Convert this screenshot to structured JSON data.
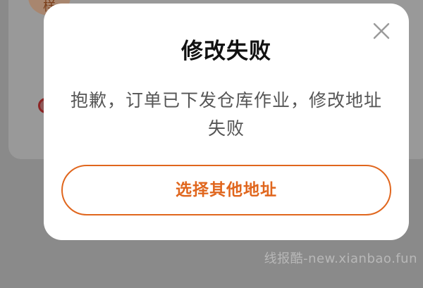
{
  "dialog": {
    "title": "修改失败",
    "message": "抱歉，订单已下发仓库作业，修改地址失败",
    "action_label": "选择其他地址",
    "close_icon": "close-icon"
  },
  "background": {
    "badge_text": "样"
  },
  "watermark": "线报酷-new.xianbao.fun",
  "colors": {
    "accent": "#e0661d",
    "overlay": "#8a8a8a",
    "dialog_bg": "#ffffff"
  }
}
